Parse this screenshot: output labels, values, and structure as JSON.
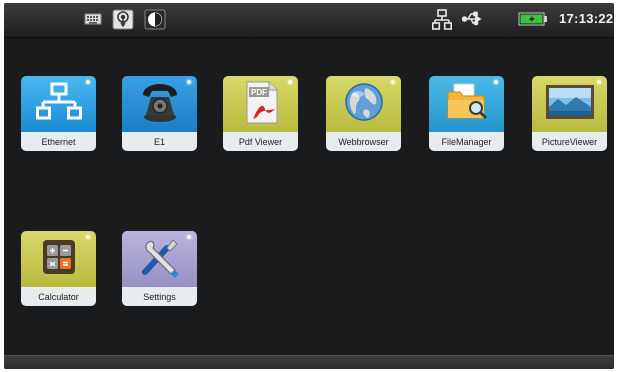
{
  "status_bar": {
    "left_icons": [
      "keyboard-icon",
      "touch-icon",
      "contrast-icon"
    ],
    "right_icons": [
      "network-icon",
      "usb-icon",
      "battery-icon"
    ],
    "clock": "17:13:22",
    "battery_color": "#3ec43a"
  },
  "apps": [
    {
      "id": "ethernet",
      "label": "Ethernet",
      "icon": "ethernet-network-icon",
      "color": "#2a9fe0"
    },
    {
      "id": "e1",
      "label": "E1",
      "icon": "telephone-icon",
      "color": "#2d8fd4"
    },
    {
      "id": "pdf",
      "label": "Pdf Viewer",
      "icon": "pdf-document-icon",
      "color": "#c5c74a"
    },
    {
      "id": "web",
      "label": "Webbrowser",
      "icon": "globe-icon",
      "color": "#c9c952"
    },
    {
      "id": "files",
      "label": "FileManager",
      "icon": "folder-search-icon",
      "color": "#36a9d8"
    },
    {
      "id": "pictures",
      "label": "PictureViewer",
      "icon": "landscape-picture-icon",
      "color": "#c8c84c"
    },
    {
      "id": "calculator",
      "label": "Calculator",
      "icon": "calculator-icon",
      "color": "#c8c64a"
    },
    {
      "id": "settings",
      "label": "Settings",
      "icon": "tools-icon",
      "color": "#a9a3d1"
    }
  ]
}
